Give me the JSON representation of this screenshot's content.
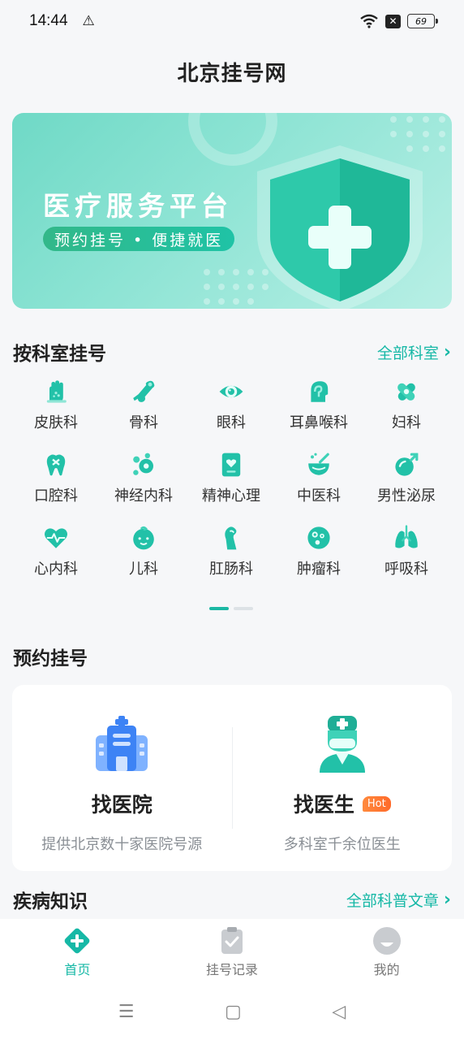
{
  "status": {
    "time": "14:44",
    "battery": "69"
  },
  "header": {
    "title": "北京挂号网"
  },
  "banner": {
    "title": "医疗服务平台",
    "subtitle": "预约挂号 • 便捷就医"
  },
  "departments": {
    "title": "按科室挂号",
    "more": "全部科室",
    "items": [
      {
        "label": "皮肤科",
        "icon": "skin-icon"
      },
      {
        "label": "骨科",
        "icon": "bone-icon"
      },
      {
        "label": "眼科",
        "icon": "eye-icon"
      },
      {
        "label": "耳鼻喉科",
        "icon": "ent-icon"
      },
      {
        "label": "妇科",
        "icon": "gynecology-icon"
      },
      {
        "label": "口腔科",
        "icon": "tooth-icon"
      },
      {
        "label": "神经内科",
        "icon": "neuron-icon"
      },
      {
        "label": "精神心理",
        "icon": "mind-icon"
      },
      {
        "label": "中医科",
        "icon": "herbal-bowl-icon"
      },
      {
        "label": "男性泌尿",
        "icon": "male-icon"
      },
      {
        "label": "心内科",
        "icon": "heart-icon"
      },
      {
        "label": "儿科",
        "icon": "child-icon"
      },
      {
        "label": "肛肠科",
        "icon": "intestine-icon"
      },
      {
        "label": "肿瘤科",
        "icon": "tumor-icon"
      },
      {
        "label": "呼吸科",
        "icon": "lungs-icon"
      }
    ]
  },
  "appointment": {
    "title": "预约挂号",
    "hospital": {
      "name": "找医院",
      "desc": "提供北京数十家医院号源"
    },
    "doctor": {
      "name": "找医生",
      "badge": "Hot",
      "desc": "多科室千余位医生"
    }
  },
  "knowledge": {
    "title": "疾病知识",
    "more": "全部科普文章"
  },
  "tabs": [
    {
      "label": "首页",
      "active": true
    },
    {
      "label": "挂号记录",
      "active": false
    },
    {
      "label": "我的",
      "active": false
    }
  ],
  "colors": {
    "accent": "#16b8a6",
    "hot": "#ff7a30"
  }
}
